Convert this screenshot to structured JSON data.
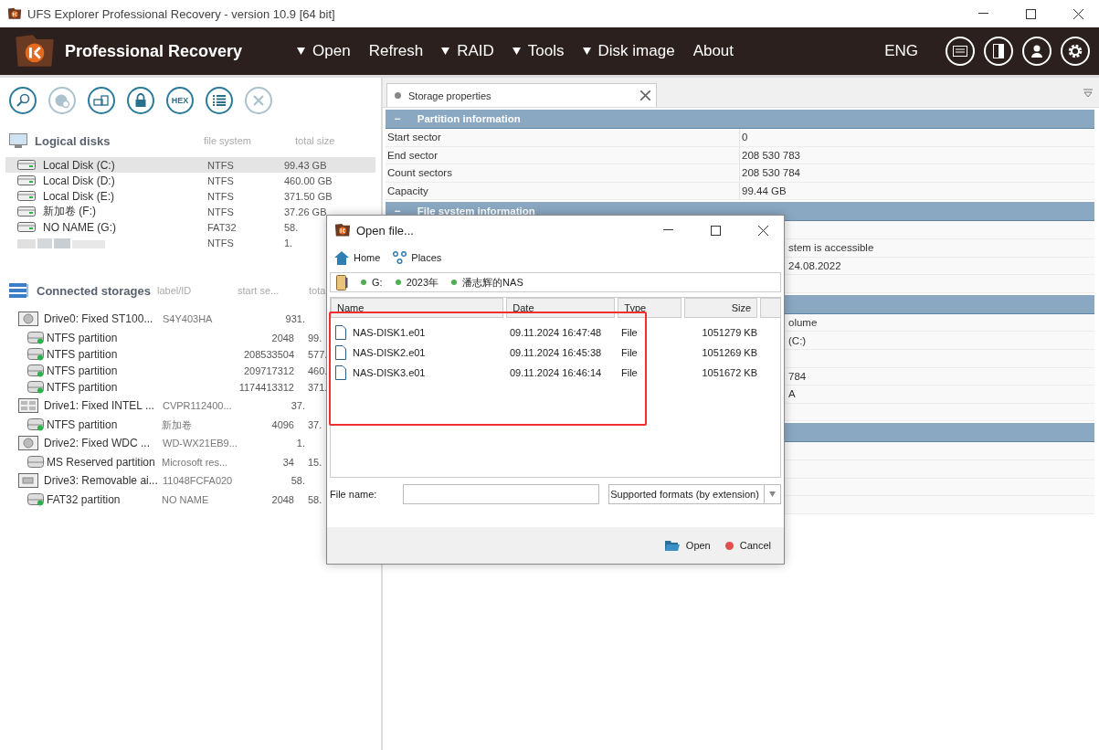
{
  "window": {
    "title": "UFS Explorer Professional Recovery - version 10.9 [64 bit]"
  },
  "menu_bar": {
    "app_name": "Professional Recovery",
    "items": [
      {
        "label": "Open",
        "dropdown": true
      },
      {
        "label": "Refresh",
        "dropdown": false
      },
      {
        "label": "RAID",
        "dropdown": true
      },
      {
        "label": "Tools",
        "dropdown": true
      },
      {
        "label": "Disk image",
        "dropdown": true
      },
      {
        "label": "About",
        "dropdown": false
      }
    ],
    "language": "ENG"
  },
  "toolbar": [
    {
      "kind": "search",
      "disabled": false
    },
    {
      "kind": "scan",
      "disabled": true
    },
    {
      "kind": "image",
      "disabled": false
    },
    {
      "kind": "lock",
      "disabled": false
    },
    {
      "kind": "hex",
      "label": "HEX",
      "disabled": false
    },
    {
      "kind": "list",
      "disabled": false
    },
    {
      "kind": "close",
      "disabled": true
    }
  ],
  "logical_disks": {
    "title": "Logical disks",
    "columns": [
      "file system",
      "total size"
    ],
    "rows": [
      {
        "name": "Local Disk (C:)",
        "file_system": "NTFS",
        "total_size": "99.43 GB",
        "selected": true,
        "blurred": false
      },
      {
        "name": "Local Disk (D:)",
        "file_system": "NTFS",
        "total_size": "460.00 GB",
        "selected": false,
        "blurred": false
      },
      {
        "name": "Local Disk (E:)",
        "file_system": "NTFS",
        "total_size": "371.50 GB",
        "selected": false,
        "blurred": false
      },
      {
        "name": "新加卷 (F:)",
        "file_system": "NTFS",
        "total_size": "37.26 GB",
        "selected": false,
        "blurred": false
      },
      {
        "name": "NO NAME (G:)",
        "file_system": "FAT32",
        "total_size": "58.",
        "selected": false,
        "blurred": false
      },
      {
        "file_system": "NTFS",
        "total_size": "1.",
        "selected": false,
        "blurred": true
      }
    ]
  },
  "connected_storages": {
    "title": "Connected storages",
    "columns": [
      "label/ID",
      "start se...",
      "tota"
    ],
    "drives": [
      {
        "kind": "hdd",
        "name": "Drive0: Fixed ST100...",
        "label": "S4Y403HA",
        "total": "931.",
        "children": [
          {
            "name": "NTFS partition",
            "start": "2048",
            "total": "99.",
            "mounted": true
          },
          {
            "name": "NTFS partition",
            "start": "208533504",
            "total": "577.",
            "mounted": true
          },
          {
            "name": "NTFS partition",
            "start": "209717312",
            "total": "460.",
            "mounted": true
          },
          {
            "name": "NTFS partition",
            "start": "1174413312",
            "total": "371.",
            "mounted": true
          }
        ]
      },
      {
        "kind": "ssd",
        "name": "Drive1: Fixed INTEL ...",
        "label": "CVPR112400...",
        "total": "37.",
        "children": [
          {
            "name": "NTFS partition",
            "label": "新加卷",
            "start": "4096",
            "total": "37.",
            "mounted": true
          }
        ]
      },
      {
        "kind": "hdd",
        "name": "Drive2: Fixed WDC ...",
        "label": "WD-WX21EB9...",
        "total": "1.",
        "children": [
          {
            "name": "MS Reserved partition",
            "label": "Microsoft res...",
            "start": "34",
            "total": "15.",
            "mounted": false
          }
        ]
      },
      {
        "kind": "usb",
        "name": "Drive3: Removable ai...",
        "label": "11048FCFA020",
        "total": "58.",
        "children": [
          {
            "name": "FAT32 partition",
            "label": "NO NAME",
            "start": "2048",
            "total": "58.",
            "mounted": true
          }
        ]
      }
    ]
  },
  "properties": {
    "tab": {
      "label": "Storage properties",
      "selected": true
    },
    "sections": [
      {
        "toggle": "−",
        "title": "Partition information",
        "rows": [
          {
            "kind": "row",
            "name": "Start sector",
            "value": "0"
          },
          {
            "kind": "row",
            "name": "End sector",
            "value": "208 530 783"
          },
          {
            "kind": "row",
            "name": "Count sectors",
            "value": "208 530 784"
          },
          {
            "kind": "row",
            "name": "Capacity",
            "value": "99.44 GB"
          }
        ]
      },
      {
        "toggle": "−",
        "title": "File system information",
        "rows": [
          {
            "kind": "blank"
          },
          {
            "kind": "covered",
            "value": "stem is accessible"
          },
          {
            "kind": "covered",
            "value": "24.08.2022"
          },
          {
            "kind": "blank"
          }
        ]
      },
      {
        "rows": [
          {
            "kind": "covered",
            "value": "olume"
          },
          {
            "kind": "covered",
            "value": "(C:)"
          },
          {
            "kind": "blank"
          },
          {
            "kind": "covered",
            "value": "784"
          },
          {
            "kind": "covered",
            "value": "A"
          },
          {
            "kind": "blank"
          }
        ]
      },
      {
        "rows": [
          {
            "kind": "blank"
          },
          {
            "kind": "blank"
          },
          {
            "kind": "blank"
          },
          {
            "kind": "blank"
          }
        ]
      }
    ]
  },
  "dialog": {
    "title": "Open file...",
    "nav": [
      "Home",
      "Places"
    ],
    "path": [
      "G:",
      "2023年",
      "潘志辉的NAS"
    ],
    "columns": [
      "Name",
      "Date",
      "Type",
      "Size"
    ],
    "files": [
      {
        "name": "NAS-DISK1.e01",
        "date": "09.11.2024 16:47:48",
        "type": "File",
        "size": "1051279 KB"
      },
      {
        "name": "NAS-DISK2.e01",
        "date": "09.11.2024 16:45:38",
        "type": "File",
        "size": "1051269 KB"
      },
      {
        "name": "NAS-DISK3.e01",
        "date": "09.11.2024 16:46:14",
        "type": "File",
        "size": "1051672 KB"
      }
    ],
    "file_name_label": "File name:",
    "format": "Supported formats (by extension)",
    "buttons": [
      {
        "kind": "open",
        "label": "Open"
      },
      {
        "kind": "cancel",
        "label": "Cancel"
      }
    ]
  }
}
